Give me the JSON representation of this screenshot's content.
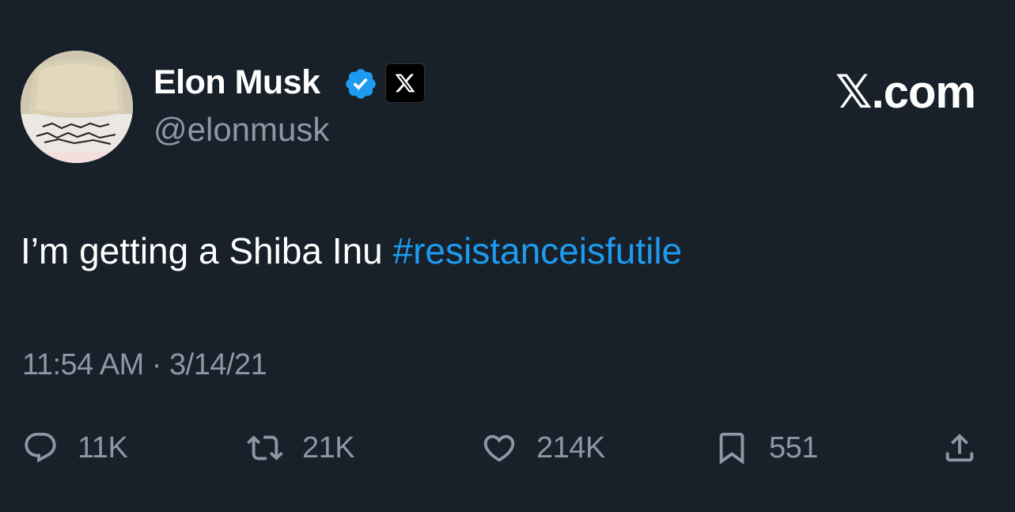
{
  "author": {
    "name": "Elon Musk",
    "handle": "@elonmusk",
    "avatar_icon": "avatar-image",
    "verified_icon": "verified-badge-icon",
    "affiliation_icon": "x-logo-icon"
  },
  "brand": {
    "wordmark": "𝕏.com"
  },
  "tweet": {
    "text_plain": "I’m getting a Shiba Inu ",
    "hashtag": "#resistanceisfutile",
    "timestamp": "11:54 AM · 3/14/21"
  },
  "actions": {
    "reply": {
      "icon": "reply-icon",
      "count": "11K"
    },
    "retweet": {
      "icon": "retweet-icon",
      "count": "21K"
    },
    "like": {
      "icon": "heart-icon",
      "count": "214K"
    },
    "bookmark": {
      "icon": "bookmark-icon",
      "count": "551"
    },
    "share": {
      "icon": "share-icon"
    }
  },
  "colors": {
    "background": "#18202a",
    "text": "#ffffff",
    "secondary": "#8b98a5",
    "accent": "#1d9bf0"
  }
}
